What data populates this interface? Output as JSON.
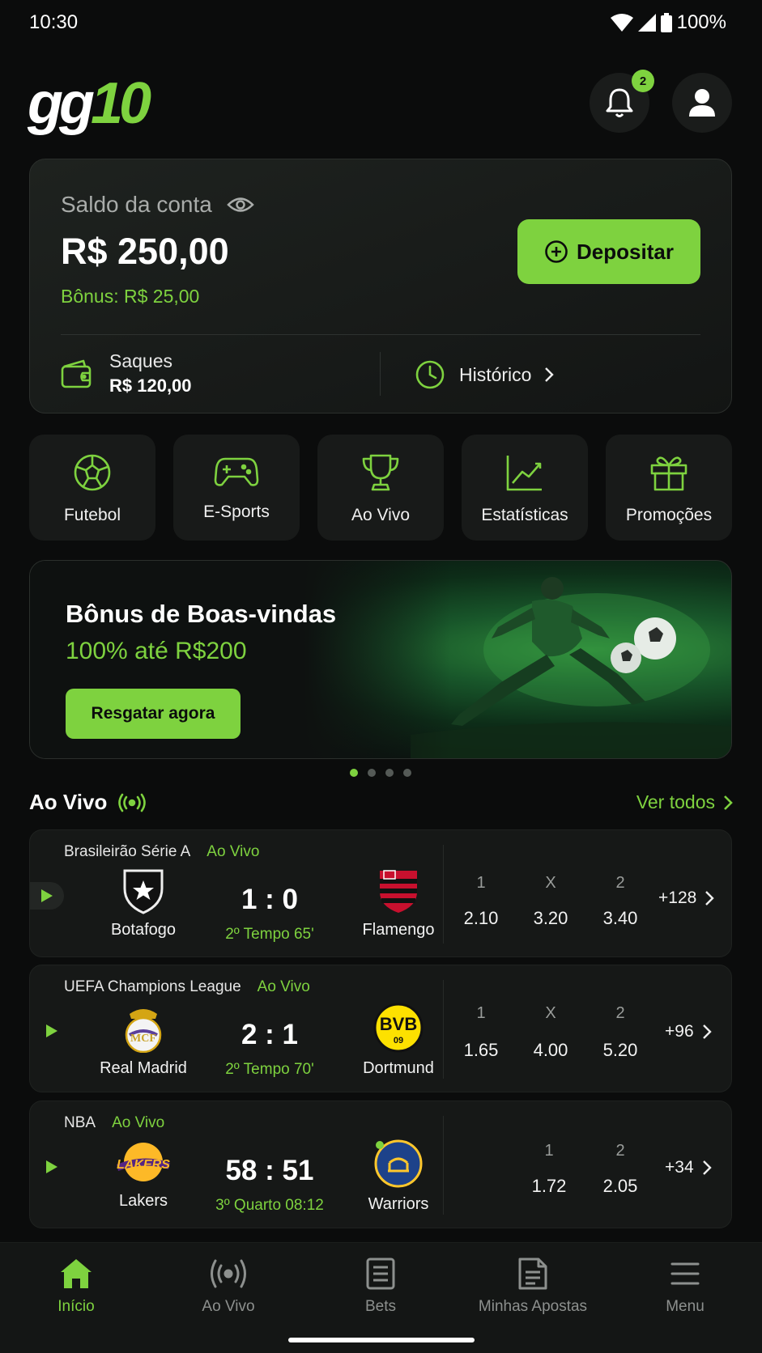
{
  "status_bar": {
    "time": "10:30",
    "battery": "100%"
  },
  "header": {
    "logo_part1": "gg",
    "logo_part2": "10",
    "notification_count": "2"
  },
  "balance": {
    "label": "Saldo da conta",
    "amount": "R$ 250,00",
    "bonus": "Bônus: R$ 25,00",
    "deposit_label": "Depositar",
    "withdrawals_label": "Saques",
    "withdrawals_value": "R$ 120,00",
    "history_label": "Histórico"
  },
  "categories": [
    {
      "label": "Futebol",
      "icon": "soccer-ball-icon"
    },
    {
      "label": "E-Sports",
      "icon": "gamepad-icon"
    },
    {
      "label": "Ao Vivo",
      "icon": "trophy-icon"
    },
    {
      "label": "Estatísticas",
      "icon": "chart-icon"
    },
    {
      "label": "Promoções",
      "icon": "gift-icon"
    }
  ],
  "banner": {
    "title": "Bônus de Boas-vindas",
    "subtitle": "100% até R$200",
    "button": "Resgatar agora",
    "slides_total": 4,
    "active_slide": 1
  },
  "live": {
    "title": "Ao Vivo",
    "see_all": "Ver todos",
    "matches": [
      {
        "league": "Brasileirão Série A",
        "status": "Ao Vivo",
        "home": "Botafogo",
        "away": "Flamengo",
        "score": "1 : 0",
        "time": "2º Tempo 65'",
        "odds": [
          {
            "label": "1",
            "value": "2.10"
          },
          {
            "label": "X",
            "value": "3.20"
          },
          {
            "label": "2",
            "value": "3.40"
          }
        ],
        "more": "+128"
      },
      {
        "league": "UEFA Champions League",
        "status": "Ao Vivo",
        "home": "Real Madrid",
        "away": "Dortmund",
        "score": "2 : 1",
        "time": "2º Tempo 70'",
        "odds": [
          {
            "label": "1",
            "value": "1.65"
          },
          {
            "label": "X",
            "value": "4.00"
          },
          {
            "label": "2",
            "value": "5.20"
          }
        ],
        "more": "+96"
      },
      {
        "league": "NBA",
        "status": "Ao Vivo",
        "home": "Lakers",
        "away": "Warriors",
        "score": "58 : 51",
        "time": "3º Quarto 08:12",
        "odds": [
          {
            "label": "1",
            "value": "1.72"
          },
          {
            "label": "2",
            "value": "2.05"
          }
        ],
        "more": "+34"
      }
    ]
  },
  "bottom_nav": [
    {
      "label": "Início",
      "icon": "home-icon",
      "active": true
    },
    {
      "label": "Ao Vivo",
      "icon": "live-broadcast-icon",
      "active": false
    },
    {
      "label": "Bets",
      "icon": "bets-list-icon",
      "active": false
    },
    {
      "label": "Minhas Apostas",
      "icon": "my-bets-icon",
      "active": false
    },
    {
      "label": "Menu",
      "icon": "menu-icon",
      "active": false
    }
  ],
  "colors": {
    "accent": "#7ed23f",
    "background": "#0b0c0c",
    "card": "#161817"
  }
}
